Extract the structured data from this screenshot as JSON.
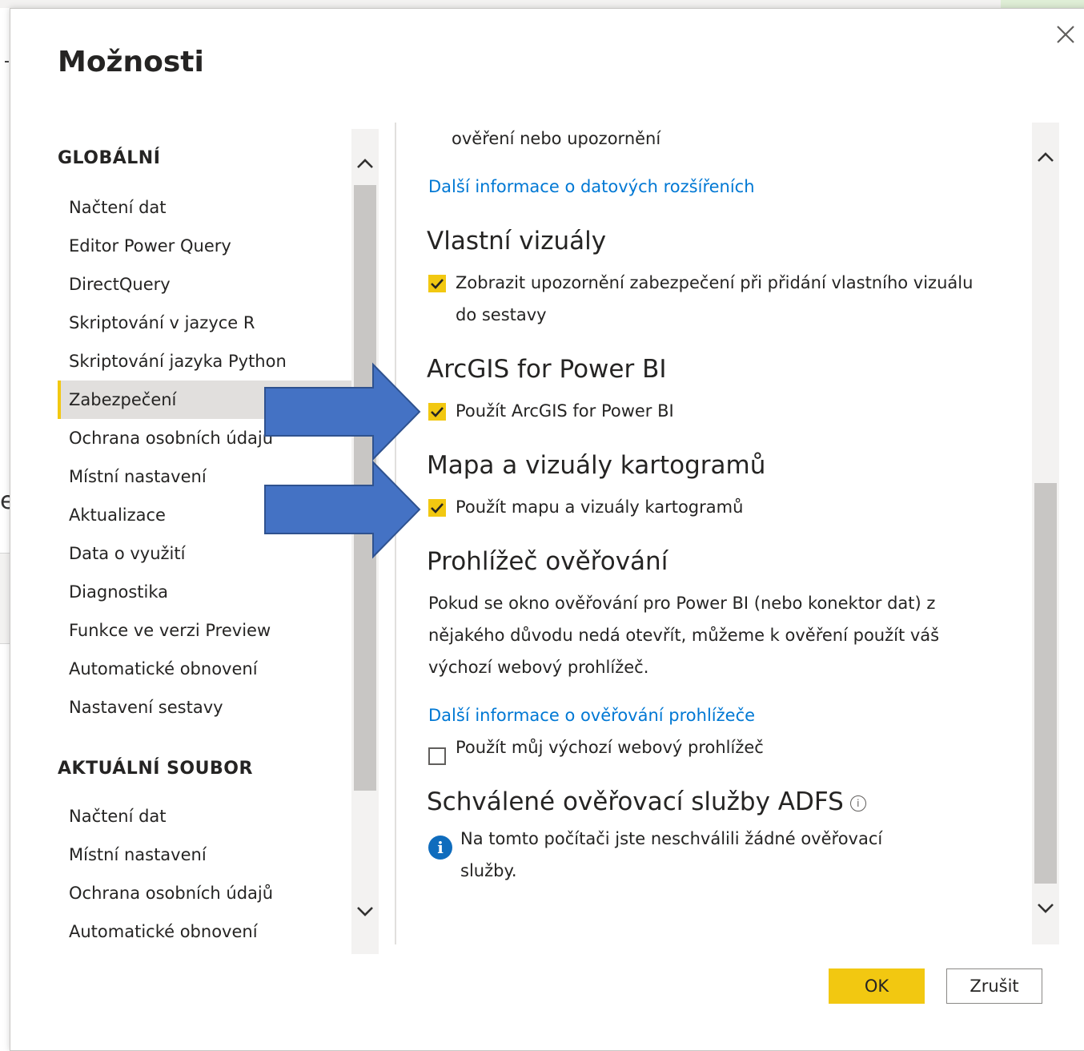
{
  "dialog": {
    "title": "Možnosti",
    "accent_color": "#f2c811",
    "link_color": "#0078d4",
    "ok_label": "OK",
    "cancel_label": "Zrušit"
  },
  "nav": {
    "global_header": "GLOBÁLNÍ",
    "global_items": [
      "Načtení dat",
      "Editor Power Query",
      "DirectQuery",
      "Skriptování v jazyce R",
      "Skriptování jazyka Python",
      "Zabezpečení",
      "Ochrana osobních údajů",
      "Místní nastavení",
      "Aktualizace",
      "Data o využití",
      "Diagnostika",
      "Funkce ve verzi Preview",
      "Automatické obnovení",
      "Nastavení sestavy"
    ],
    "selected_item": "Zabezpečení",
    "current_header": "AKTUÁLNÍ SOUBOR",
    "current_items": [
      "Načtení dat",
      "Místní nastavení",
      "Ochrana osobních údajů",
      "Automatické obnovení"
    ]
  },
  "content": {
    "top_text": "ověření nebo upozornění",
    "data_ext_link": "Další informace o datových rozšířeních",
    "custom_visuals": {
      "heading": "Vlastní vizuály",
      "option_line1": "Zobrazit upozornění zabezpečení při přidání vlastního vizuálu",
      "option_line2": "do sestavy",
      "checked": true
    },
    "arcgis": {
      "heading": "ArcGIS for Power BI",
      "option": "Použít ArcGIS for Power BI",
      "checked": true
    },
    "maps": {
      "heading": "Mapa a vizuály kartogramů",
      "option": "Použít mapu a vizuály kartogramů",
      "checked": true
    },
    "auth_browser": {
      "heading": "Prohlížeč ověřování",
      "desc_line1": "Pokud se okno ověřování pro Power BI (nebo konektor dat) z",
      "desc_line2": "nějakého důvodu nedá otevřít, můžeme k ověření použít váš",
      "desc_line3": "výchozí webový prohlížeč.",
      "link": "Další informace o ověřování prohlížeče",
      "option": "Použít můj výchozí webový prohlížeč",
      "checked": false
    },
    "adfs": {
      "heading": "Schválené ověřovací služby ADFS",
      "info_line1": "Na tomto počítači jste neschválili žádné ověřovací",
      "info_line2": "služby."
    }
  },
  "annotation": {
    "arrow_color": "#4472c4"
  }
}
